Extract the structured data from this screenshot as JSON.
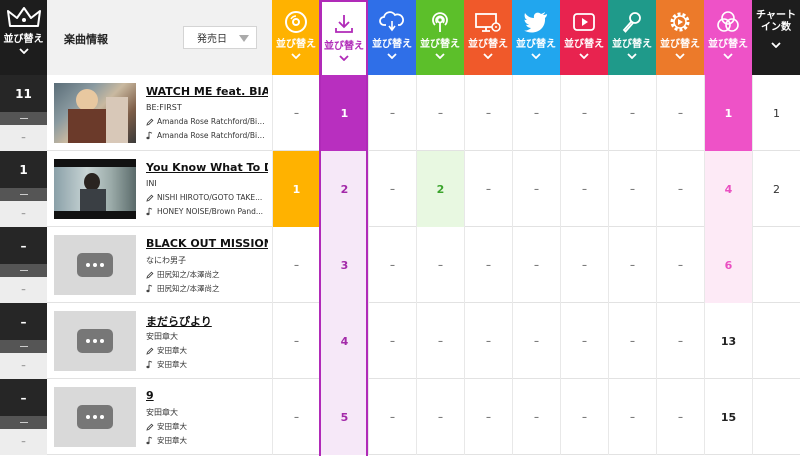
{
  "header": {
    "sort_label": "並び替え",
    "info_title": "楽曲情報",
    "release_select": "発売日",
    "chart_in_label_1": "チャート",
    "chart_in_label_2": "イン数",
    "colors": {
      "cd": "#ffb200",
      "download": "#b02ab8",
      "streaming": "#2f6fe8",
      "radio": "#5cbf2a",
      "look": "#f0592a",
      "twitter": "#21a6ee",
      "youtube": "#e8234f",
      "karaoke": "#1f9a8a",
      "gyao": "#ec7a2a",
      "total": "#ee52c7",
      "dark": "#1d1d1d"
    },
    "columns": [
      {
        "key": "cd",
        "icon": "cd-icon"
      },
      {
        "key": "download",
        "icon": "download-icon"
      },
      {
        "key": "streaming",
        "icon": "streaming-cloud-icon"
      },
      {
        "key": "radio",
        "icon": "radio-icon"
      },
      {
        "key": "look",
        "icon": "pc-tv-icon"
      },
      {
        "key": "twitter",
        "icon": "twitter-bird-icon"
      },
      {
        "key": "youtube",
        "icon": "video-play-icon"
      },
      {
        "key": "karaoke",
        "icon": "microphone-icon"
      },
      {
        "key": "gyao",
        "icon": "gear-play-icon"
      },
      {
        "key": "total",
        "icon": "circles-icon"
      }
    ]
  },
  "rows": [
    {
      "rank": "11",
      "prev": "–",
      "title": "WATCH ME feat. BIA",
      "artist": "BE:FIRST",
      "lyricist": "Amanda Rose Ratchford/Bia...",
      "composer": "Amanda Rose Ratchford/Bia...",
      "thumb": "photo",
      "values": [
        "–",
        "1",
        "–",
        "–",
        "–",
        "–",
        "–",
        "–",
        "–",
        "1"
      ],
      "chart_in": "1"
    },
    {
      "rank": "1",
      "prev": "–",
      "title": "You Know What To Do",
      "artist": "INI",
      "lyricist": "NISHI HIROTO/GOTO TAKE...",
      "composer": "HONEY NOISE/Brown Pand...",
      "thumb": "photo",
      "values": [
        "1",
        "2",
        "–",
        "2",
        "–",
        "–",
        "–",
        "–",
        "–",
        "4"
      ],
      "chart_in": "2"
    },
    {
      "rank": "–",
      "prev": "–",
      "title": "BLACK OUT MISSION",
      "artist": "なにわ男子",
      "lyricist": "田尻知之/本澤尚之",
      "composer": "田尻知之/本澤尚之",
      "thumb": "placeholder",
      "values": [
        "–",
        "3",
        "–",
        "–",
        "–",
        "–",
        "–",
        "–",
        "–",
        "6"
      ],
      "chart_in": ""
    },
    {
      "rank": "–",
      "prev": "–",
      "title": "まだらぴより",
      "artist": "安田章大",
      "lyricist": "安田章大",
      "composer": "安田章大",
      "thumb": "placeholder",
      "values": [
        "–",
        "4",
        "–",
        "–",
        "–",
        "–",
        "–",
        "–",
        "–",
        "13"
      ],
      "chart_in": ""
    },
    {
      "rank": "–",
      "prev": "–",
      "title": "9",
      "artist": "安田章大",
      "lyricist": "安田章大",
      "composer": "安田章大",
      "thumb": "placeholder",
      "values": [
        "–",
        "5",
        "–",
        "–",
        "–",
        "–",
        "–",
        "–",
        "–",
        "15"
      ],
      "chart_in": ""
    }
  ]
}
